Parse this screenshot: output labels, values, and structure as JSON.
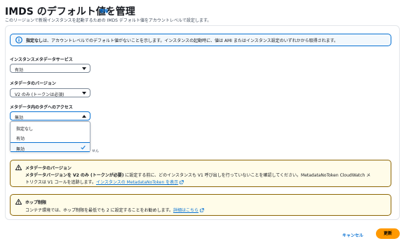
{
  "header": {
    "title": "IMDS のデフォルト値を管理",
    "info_link": "情報",
    "subtitle": "このリージョンで新規インスタンスを起動するための IMDS デフォルト値をアカウントレベルで設定します。"
  },
  "info_alert": {
    "bold": "指定なし",
    "text": "は、アカウントレベルでのデフォルト値がないことを示します。インスタンスの起動時に、値は AMI またはインスタンス設定のいずれかから取得されます。"
  },
  "fields": {
    "service": {
      "label": "インスタンスメタデータサービス",
      "value": "有効"
    },
    "version": {
      "label": "メタデータのバージョン",
      "value": "V2 のみ (トークンは必須)"
    },
    "tag": {
      "label": "メタデータ内のタグへのアクセス",
      "value": "無効"
    }
  },
  "dropdown": {
    "options": [
      "指定なし",
      "有効",
      "無効"
    ],
    "selected_index": 2,
    "hidden_tail": "せん"
  },
  "warning_version": {
    "title": "メタデータのバージョン",
    "line1_bold": "メタデータバージョンを V2 のみ (トークンが必要)",
    "line1_text": " に設定する前に、どのインスタンスも V1 呼び出しを行っていないことを確認してください。MetadataNoToken CloudWatch メ",
    "line2_text": "トリクスは V1 コールを追跡します。",
    "line2_link": "インスタンスの MetadataNoToken を表示"
  },
  "warning_hop": {
    "title": "ホップ制限",
    "text": "コンテナ環境では、ホップ制限を最低でも 2 に設定することをお勧めします。",
    "link": "詳細はこちら"
  },
  "footer": {
    "cancel_label": "キャンセル",
    "update_label": "更新"
  },
  "colors": {
    "accent": "#0972d3",
    "primary_button": "#ff9900",
    "warning_border": "#8d6605",
    "warning_bg": "#fffce9",
    "info_bg": "#f2f8fd"
  }
}
